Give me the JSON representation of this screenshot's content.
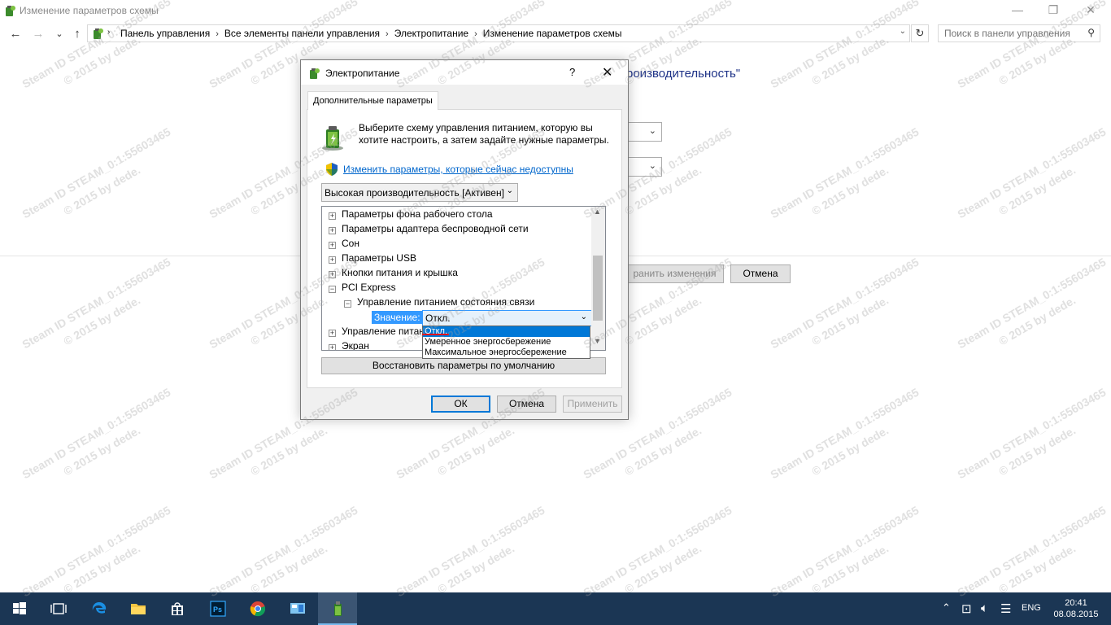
{
  "window": {
    "title": "Изменение параметров схемы",
    "min_glyph": "—",
    "restore_glyph": "❐",
    "close_glyph": "✕"
  },
  "nav": {
    "back": "←",
    "forward": "→",
    "recent": "⌄",
    "up": "↑"
  },
  "breadcrumbs": [
    "Панель управления",
    "Все элементы панели управления",
    "Электропитание",
    "Изменение параметров схемы"
  ],
  "search": {
    "placeholder": "Поиск в панели управления"
  },
  "background": {
    "heading": "роизводительность\"",
    "save_button": "ранить изменения",
    "cancel_button": "Отмена"
  },
  "dialog": {
    "title": "Электропитание",
    "help": "?",
    "close": "✕",
    "tab": "Дополнительные параметры",
    "description": "Выберите схему управления питанием, которую вы хотите настроить, а затем задайте нужные параметры.",
    "link": "Изменить параметры, которые сейчас недоступны",
    "scheme": "Высокая производительность [Активен]",
    "tree": [
      {
        "label": "Параметры фона рабочего стола",
        "expander": "+"
      },
      {
        "label": "Параметры адаптера беспроводной сети",
        "expander": "+"
      },
      {
        "label": "Сон",
        "expander": "+"
      },
      {
        "label": "Параметры USB",
        "expander": "+"
      },
      {
        "label": "Кнопки питания и крышка",
        "expander": "+"
      },
      {
        "label": "PCI Express",
        "expander": "−"
      },
      {
        "label": "Управление питанием состояния связи",
        "expander": "−"
      },
      {
        "label": "Управление питан",
        "expander": "+"
      },
      {
        "label": "Экран",
        "expander": "+"
      }
    ],
    "value_label": "Значение:",
    "value_selected": "Откл.",
    "dropdown_options": [
      "Откл.",
      "Умеренное энергосбережение",
      "Максимальное энергосбережение"
    ],
    "restore_defaults": "Восстановить параметры по умолчанию",
    "ok": "ОК",
    "cancel": "Отмена",
    "apply": "Применить"
  },
  "watermark": {
    "line1": "Steam ID  STEAM_0:1:55603465",
    "line2": "© 2015 by dede."
  },
  "taskbar": {
    "apps": [
      "start-icon",
      "task-view-icon",
      "edge-icon",
      "explorer-icon",
      "store-icon",
      "photoshop-icon",
      "chrome-icon",
      "control-panel-icon",
      "power-options-icon"
    ],
    "language": "ENG",
    "time": "20:41",
    "date": "08.08.2015"
  },
  "colors": {
    "taskbar": "#1b3654",
    "accent": "#0078d7",
    "link": "#0066cc"
  }
}
